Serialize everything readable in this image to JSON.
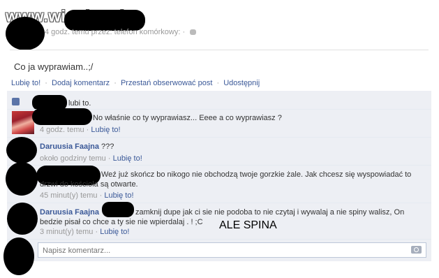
{
  "watermark": "www.wiocha.pl",
  "post": {
    "meta": "4 godz. temu przez: telefon komórkowy:",
    "meta_dot": "·",
    "text": "Co ja wyprawiam..;/"
  },
  "actions": {
    "like": "Lubię to!",
    "comment": "Dodaj komentarz",
    "unfollow": "Przestań obserwować post",
    "share": "Udostępnij",
    "sep": "·"
  },
  "likes": {
    "text": "lubi to."
  },
  "comments": [
    {
      "author": "",
      "text": "No właśnie co ty wyprawiasz... Eeee a co wyprawiasz ?",
      "time": "4 godz. temu",
      "like": "Lubię to!"
    },
    {
      "author": "Daruusia Faajna",
      "text": "???",
      "time": "około godziny temu",
      "like": "Lubię to!"
    },
    {
      "author": "",
      "text_line1": "Weź już skończ bo nikogo nie obchodzą twoje gorzkie żale. Jak chcesz się wyspowiadać to",
      "text_line2": "drzwi do kościoła są otwarte.",
      "time": "45 minut(y) temu",
      "like": "Lubię to!"
    },
    {
      "author": "Daruusia Faajna",
      "text_line1": "zamknij dupe jak ci sie nie podoba to nie czytaj i wywalaj a nie spiny walisz, On",
      "text_line2": "bedzie pisał co chce a ty sie nie wpierdalaj . ! ;C",
      "time": "3 minut(y) temu",
      "like": "Lubię to!"
    }
  ],
  "overlay_text": "ALE SPINA",
  "comment_input": {
    "placeholder": "Napisz komentarz..."
  },
  "icons": {
    "camera": "camera-icon",
    "like": "thumbs-up-icon",
    "audience": "friends-icon"
  },
  "colors": {
    "link": "#3b5998",
    "ufi_bg": "#edeff4",
    "meta": "#999999"
  }
}
